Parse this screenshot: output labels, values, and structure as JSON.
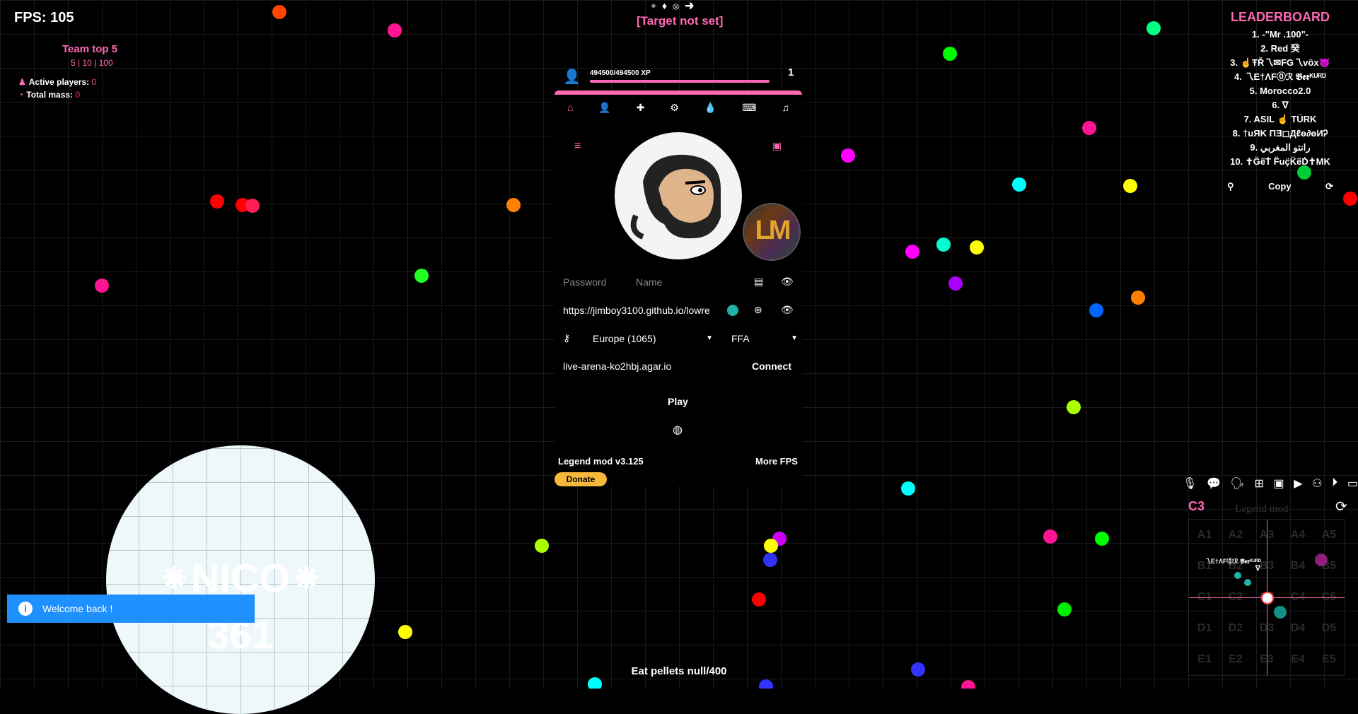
{
  "hud": {
    "fps": "FPS: 105",
    "team_top": "Team top 5",
    "team_sizes": "5 | 10 | 100",
    "active_players_label": "Active players:",
    "active_players_value": "0",
    "total_mass_label": "Total mass:",
    "total_mass_value": "0",
    "target": "[Target not set]",
    "eat_pellets": "Eat pellets null/400"
  },
  "profile": {
    "xp": "494500/494500 XP",
    "xp_fraction": 1.0,
    "level": "1"
  },
  "menu": {
    "tabs": [
      {
        "icon": "home-icon",
        "glyph": "⌂",
        "active": true
      },
      {
        "icon": "user-icon",
        "glyph": "👤",
        "active": false
      },
      {
        "icon": "puzzle-icon",
        "glyph": "✚",
        "active": false
      },
      {
        "icon": "gear-icon",
        "glyph": "⚙",
        "active": false
      },
      {
        "icon": "drop-icon",
        "glyph": "💧",
        "active": false
      },
      {
        "icon": "keyboard-icon",
        "glyph": "⌨",
        "active": false
      },
      {
        "icon": "music-icon",
        "glyph": "♫",
        "active": false
      }
    ],
    "password_placeholder": "Password",
    "name_placeholder": "Name",
    "skin_url": "https://jimboy3100.github.io/lowre",
    "region": "Europe (1065)",
    "mode": "FFA",
    "server": "live-arena-ko2hbj.agar.io",
    "connect_label": "Connect",
    "play_label": "Play",
    "footer_title": "Legend mod v3.125",
    "more_fps": "More FPS",
    "donate": "Donate",
    "skin2_letters": "LM"
  },
  "leaderboard": {
    "title": "LEADERBOARD",
    "items": [
      "1. -\"Mr .100\"-",
      "2. Red 癸",
      "3. ☝ŦŘ乁✉FG乁vöx😈",
      "4. 乁E†ΛF⓪ℛ 𝕭𝖊𝖗ᴷᵁᴿᴰ",
      "5. Morocco2.0",
      "6. ∇",
      "7. ASIL ☝ TÜRK",
      "8. †uЯK ΠƎ◻Дℓѳ∂ѳИᎮ",
      "9. رانتو المغربي",
      "10. ✝G̈ẽṪ F̈uç̈K̈ẽḊ✝MK"
    ],
    "copy_label": "Copy"
  },
  "player_cell": {
    "name": "⁕NICO⁕",
    "mass": "361"
  },
  "toast": {
    "message": "Welcome back !"
  },
  "minimap": {
    "sector": "C3",
    "title": "Legend mod",
    "cells": [
      "A1",
      "A2",
      "A3",
      "A4",
      "A5",
      "B1",
      "B2",
      "B3",
      "B4",
      "B5",
      "C1",
      "C2",
      "C3",
      "C4",
      "C5",
      "D1",
      "D2",
      "D3",
      "D4",
      "D5",
      "E1",
      "E2",
      "E3",
      "E4",
      "E5"
    ],
    "player_label": "乁E†ΛF⓪ℛ 𝕭𝖊𝖗ᴷᵁᴿᴰ",
    "player_label2": "∇",
    "toolbar_icons": [
      "microphone-icon",
      "chat-icon",
      "voice-icon",
      "tree-icon",
      "image-icon",
      "youtube-icon",
      "binoculars-icon",
      "play-icon",
      "monitor-icon"
    ]
  },
  "colors": {
    "accent": "#ff69b4",
    "toast": "#1e90ff",
    "donate": "#f5b83b"
  }
}
